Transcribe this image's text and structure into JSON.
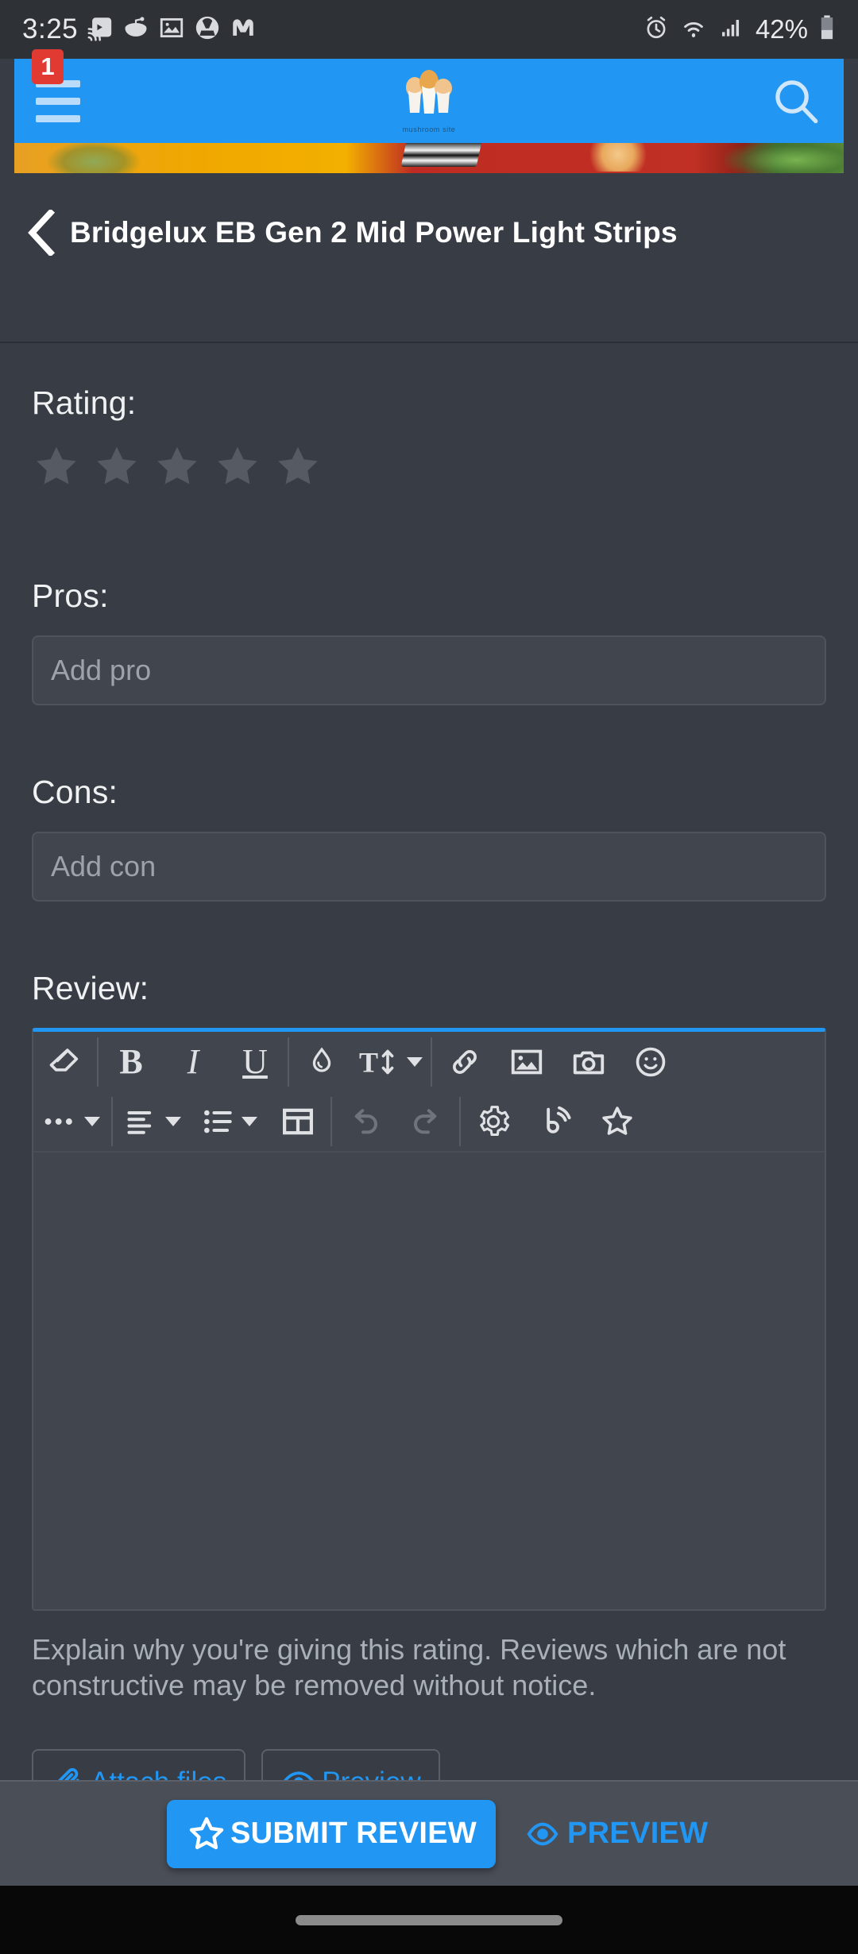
{
  "status_bar": {
    "time": "3:25",
    "battery_percent": "42%",
    "left_icons": [
      "cast-icon",
      "reddit-icon",
      "gallery-icon",
      "vlc-icon",
      "malwarebytes-icon"
    ],
    "right_icons": [
      "alarm-icon",
      "wifi-icon",
      "signal-icon",
      "battery-icon"
    ]
  },
  "app_header": {
    "menu_badge": "1",
    "menu_icon": "hamburger-menu-icon",
    "logo_caption": "mushroom site",
    "search_icon": "search-icon",
    "accent_color": "#2196f3"
  },
  "title_bar": {
    "back_icon": "back-chevron-icon",
    "title": "Bridgelux EB Gen 2 Mid Power Light Strips"
  },
  "form": {
    "rating": {
      "label": "Rating:",
      "value": 0,
      "max": 5,
      "star_icon": "star-icon",
      "empty_color": "#555a63"
    },
    "pros": {
      "label": "Pros:",
      "placeholder": "Add pro",
      "value": ""
    },
    "cons": {
      "label": "Cons:",
      "placeholder": "Add con",
      "value": ""
    },
    "review": {
      "label": "Review:",
      "value": "",
      "helper_text": "Explain why you're giving this rating. Reviews which are not constructive may be removed without notice."
    }
  },
  "editor_toolbar": {
    "row1": [
      {
        "name": "clear-formatting-icon",
        "label": "",
        "enabled": true
      },
      {
        "name": "bold-icon",
        "label": "B",
        "enabled": true
      },
      {
        "name": "italic-icon",
        "label": "I",
        "enabled": true
      },
      {
        "name": "underline-icon",
        "label": "U",
        "enabled": true
      },
      {
        "name": "text-color-icon",
        "label": "",
        "enabled": true
      },
      {
        "name": "font-size-icon",
        "label": "T",
        "enabled": true
      },
      {
        "name": "link-icon",
        "label": "",
        "enabled": true
      },
      {
        "name": "insert-image-icon",
        "label": "",
        "enabled": true
      },
      {
        "name": "camera-icon",
        "label": "",
        "enabled": true
      },
      {
        "name": "emoji-icon",
        "label": "",
        "enabled": true
      }
    ],
    "row2": [
      {
        "name": "more-options-icon",
        "label": "",
        "enabled": true
      },
      {
        "name": "align-icon",
        "label": "",
        "enabled": true
      },
      {
        "name": "list-icon",
        "label": "",
        "enabled": true
      },
      {
        "name": "table-icon",
        "label": "",
        "enabled": true
      },
      {
        "name": "undo-icon",
        "label": "",
        "enabled": false
      },
      {
        "name": "redo-icon",
        "label": "",
        "enabled": false
      },
      {
        "name": "settings-gear-icon",
        "label": "",
        "enabled": true
      },
      {
        "name": "bbcode-icon",
        "label": "",
        "enabled": true
      },
      {
        "name": "star-icon",
        "label": "",
        "enabled": true
      }
    ]
  },
  "actions": {
    "attach_files": {
      "label": "Attach files",
      "icon": "paperclip-icon"
    },
    "preview": {
      "label": "Preview",
      "icon": "eye-icon"
    }
  },
  "bottom_bar": {
    "submit": {
      "label": "SUBMIT REVIEW",
      "icon": "star-icon"
    },
    "preview": {
      "label": "PREVIEW",
      "icon": "eye-icon"
    }
  }
}
